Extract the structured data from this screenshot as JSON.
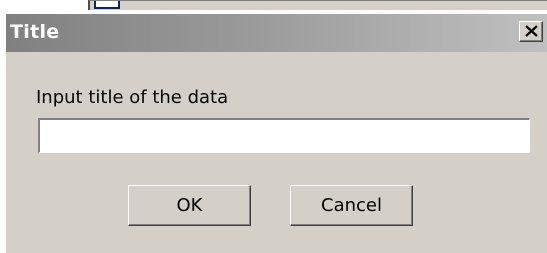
{
  "dialog": {
    "title": "Title",
    "close_icon": "close-icon",
    "prompt": "Input title of the data",
    "input_value": "",
    "ok_label": "OK",
    "cancel_label": "Cancel"
  },
  "colors": {
    "dialog_face": "#d4d0c8",
    "titlebar_inactive_start": "#808080",
    "titlebar_inactive_end": "#c0c0c0",
    "title_text": "#ffffff"
  }
}
